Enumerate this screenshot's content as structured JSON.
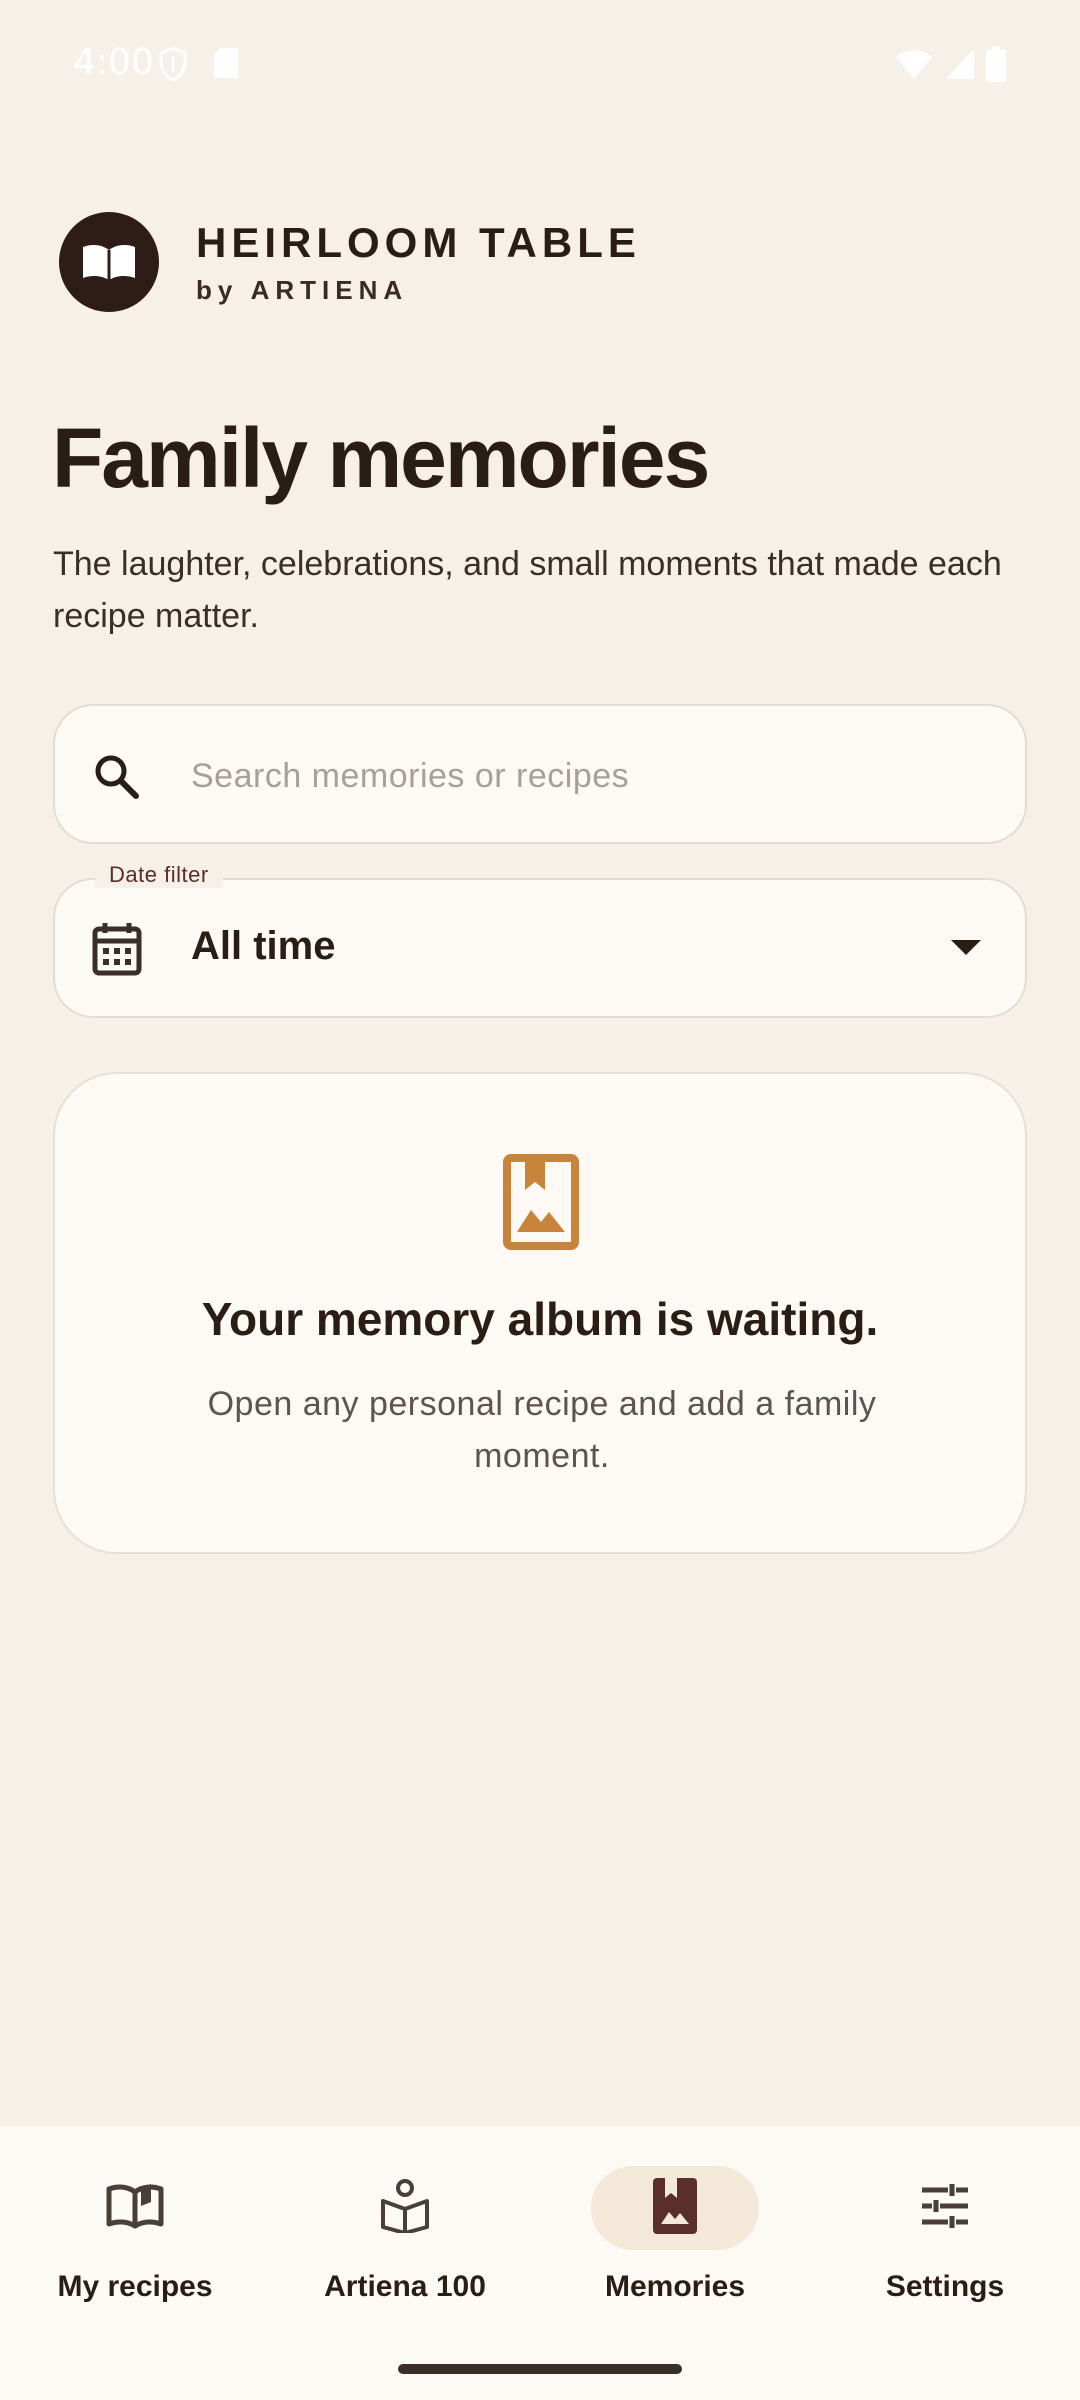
{
  "status": {
    "time": "4:00",
    "left_icons": [
      "shield-icon",
      "sd-card-icon"
    ],
    "right_icons": [
      "wifi-icon",
      "signal-icon",
      "battery-icon"
    ]
  },
  "brand": {
    "title": "HEIRLOOM TABLE",
    "subtitle": "by ARTIENA",
    "logo_icon": "open-book-icon"
  },
  "page": {
    "title": "Family memories",
    "description": "The laughter, celebrations, and small moments that made each recipe matter."
  },
  "search": {
    "placeholder": "Search memories or recipes",
    "value": ""
  },
  "date_filter": {
    "label": "Date filter",
    "value": "All time"
  },
  "empty_state": {
    "icon": "photo-album-icon",
    "title": "Your memory album is waiting.",
    "description": "Open any personal recipe and add a family moment."
  },
  "nav": {
    "items": [
      {
        "label": "My recipes",
        "icon": "book-open-icon",
        "active": false
      },
      {
        "label": "Artiena 100",
        "icon": "reader-icon",
        "active": false
      },
      {
        "label": "Memories",
        "icon": "photo-album-icon",
        "active": true
      },
      {
        "label": "Settings",
        "icon": "tune-icon",
        "active": false
      }
    ]
  },
  "colors": {
    "background": "#F6F0E8",
    "surface": "#FDF9F4",
    "text": "#2A1D16",
    "accent": "#C9843B",
    "nav_active_pill": "#F4E8D9",
    "logo_bg": "#2E1C16"
  }
}
